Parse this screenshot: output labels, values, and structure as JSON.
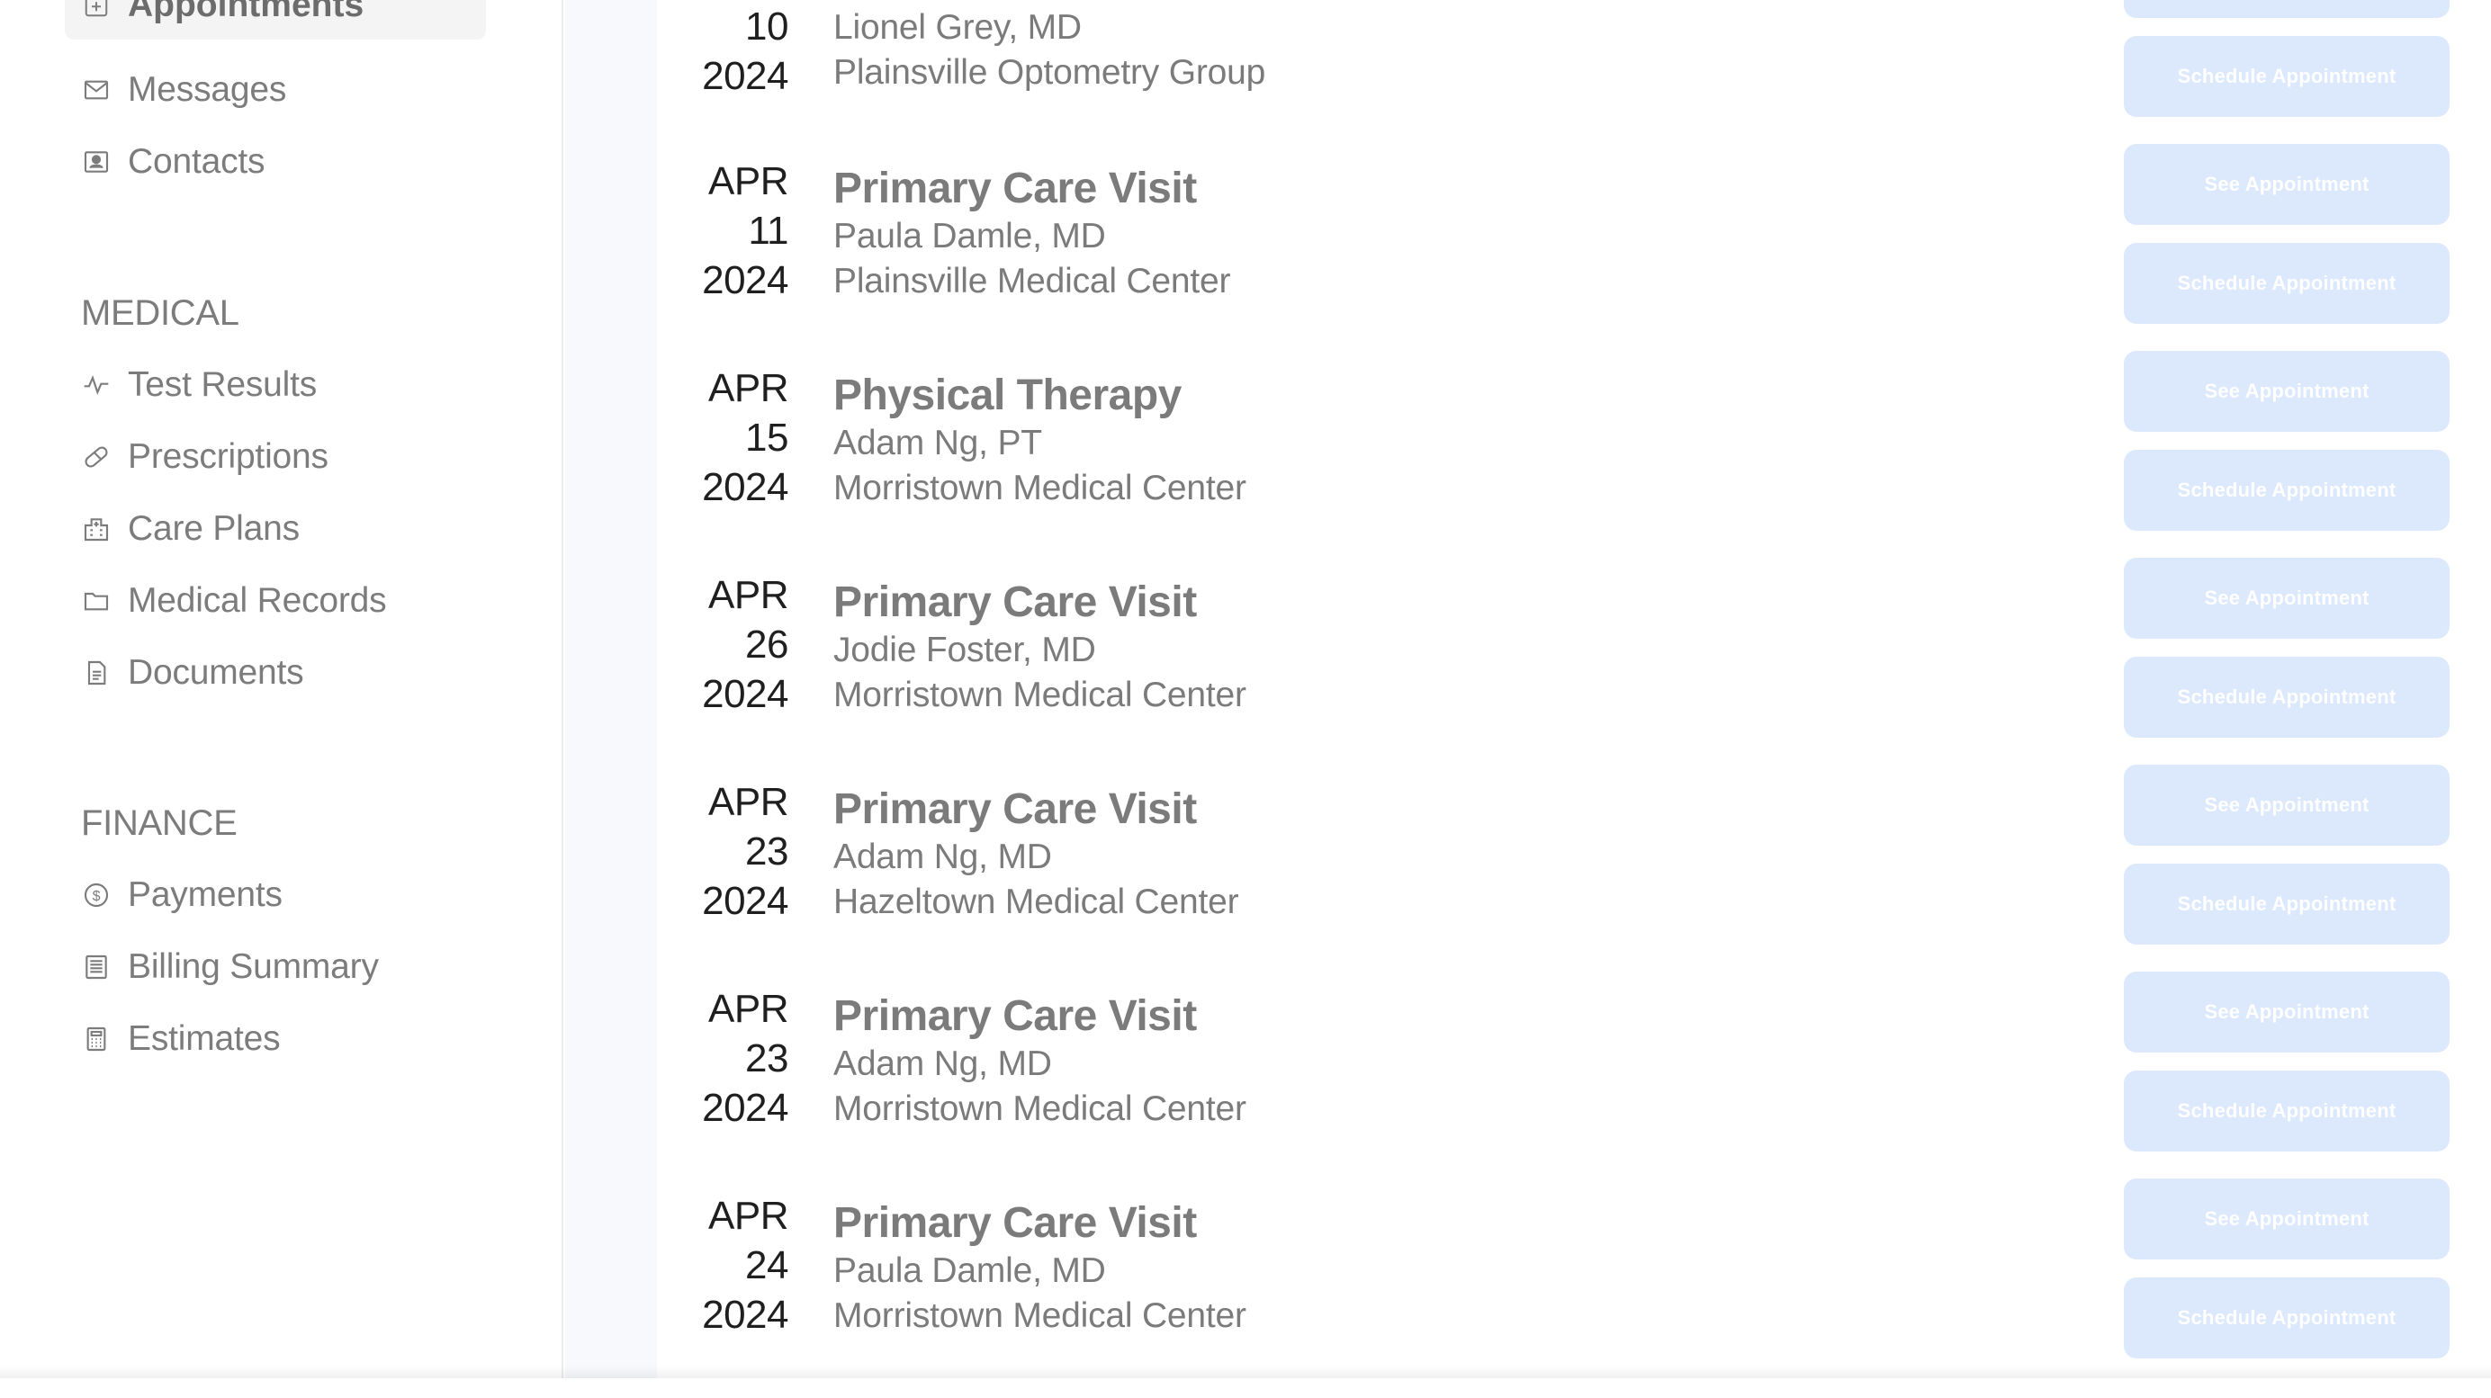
{
  "sidebar": {
    "active_item": {
      "label": "Appointments",
      "icon": "calendar-plus-icon"
    },
    "top_items": [
      {
        "label": "Messages",
        "icon": "envelope-icon"
      },
      {
        "label": "Contacts",
        "icon": "contact-card-icon"
      }
    ],
    "medical": {
      "title": "MEDICAL",
      "items": [
        {
          "label": "Test Results",
          "icon": "pulse-icon"
        },
        {
          "label": "Prescriptions",
          "icon": "pill-icon"
        },
        {
          "label": "Care Plans",
          "icon": "hospital-icon"
        },
        {
          "label": "Medical Records",
          "icon": "folder-icon"
        },
        {
          "label": "Documents",
          "icon": "document-icon"
        }
      ]
    },
    "finance": {
      "title": "FINANCE",
      "items": [
        {
          "label": "Payments",
          "icon": "dollar-coin-icon"
        },
        {
          "label": "Billing Summary",
          "icon": "ledger-icon"
        },
        {
          "label": "Estimates",
          "icon": "calculator-icon"
        }
      ]
    }
  },
  "appointments": [
    {
      "month": "",
      "day": "10",
      "year": "2024",
      "title": "",
      "provider": "Lionel Grey, MD",
      "location": "Plainsville Optometry Group",
      "schedule_label": "Schedule Appointment"
    },
    {
      "month": "APR",
      "day": "11",
      "year": "2024",
      "title": "Primary Care Visit",
      "provider": "Paula Damle, MD",
      "location": "Plainsville Medical Center",
      "see_label": "See Appointment",
      "schedule_label": "Schedule Appointment"
    },
    {
      "month": "APR",
      "day": "15",
      "year": "2024",
      "title": "Physical Therapy",
      "provider": "Adam Ng, PT",
      "location": "Morristown Medical Center",
      "see_label": "See Appointment",
      "schedule_label": "Schedule Appointment"
    },
    {
      "month": "APR",
      "day": "26",
      "year": "2024",
      "title": "Primary Care Visit",
      "provider": "Jodie Foster, MD",
      "location": "Morristown Medical Center",
      "see_label": "See Appointment",
      "schedule_label": "Schedule Appointment"
    },
    {
      "month": "APR",
      "day": "23",
      "year": "2024",
      "title": "Primary Care Visit",
      "provider": "Adam Ng, MD",
      "location": "Hazeltown Medical Center",
      "see_label": "See Appointment",
      "schedule_label": "Schedule Appointment"
    },
    {
      "month": "APR",
      "day": "23",
      "year": "2024",
      "title": "Primary Care Visit",
      "provider": "Adam Ng, MD",
      "location": "Morristown Medical Center",
      "see_label": "See Appointment",
      "schedule_label": "Schedule Appointment"
    },
    {
      "month": "APR",
      "day": "24",
      "year": "2024",
      "title": "Primary Care Visit",
      "provider": "Paula Damle, MD",
      "location": "Morristown Medical Center",
      "see_label": "See Appointment",
      "schedule_label": "Schedule Appointment"
    }
  ],
  "colors": {
    "button_bg": "#dce8fc",
    "gutter_bg": "#f7f9fd",
    "text_muted": "#7b7b7b",
    "date_text": "#1f1f1f"
  }
}
